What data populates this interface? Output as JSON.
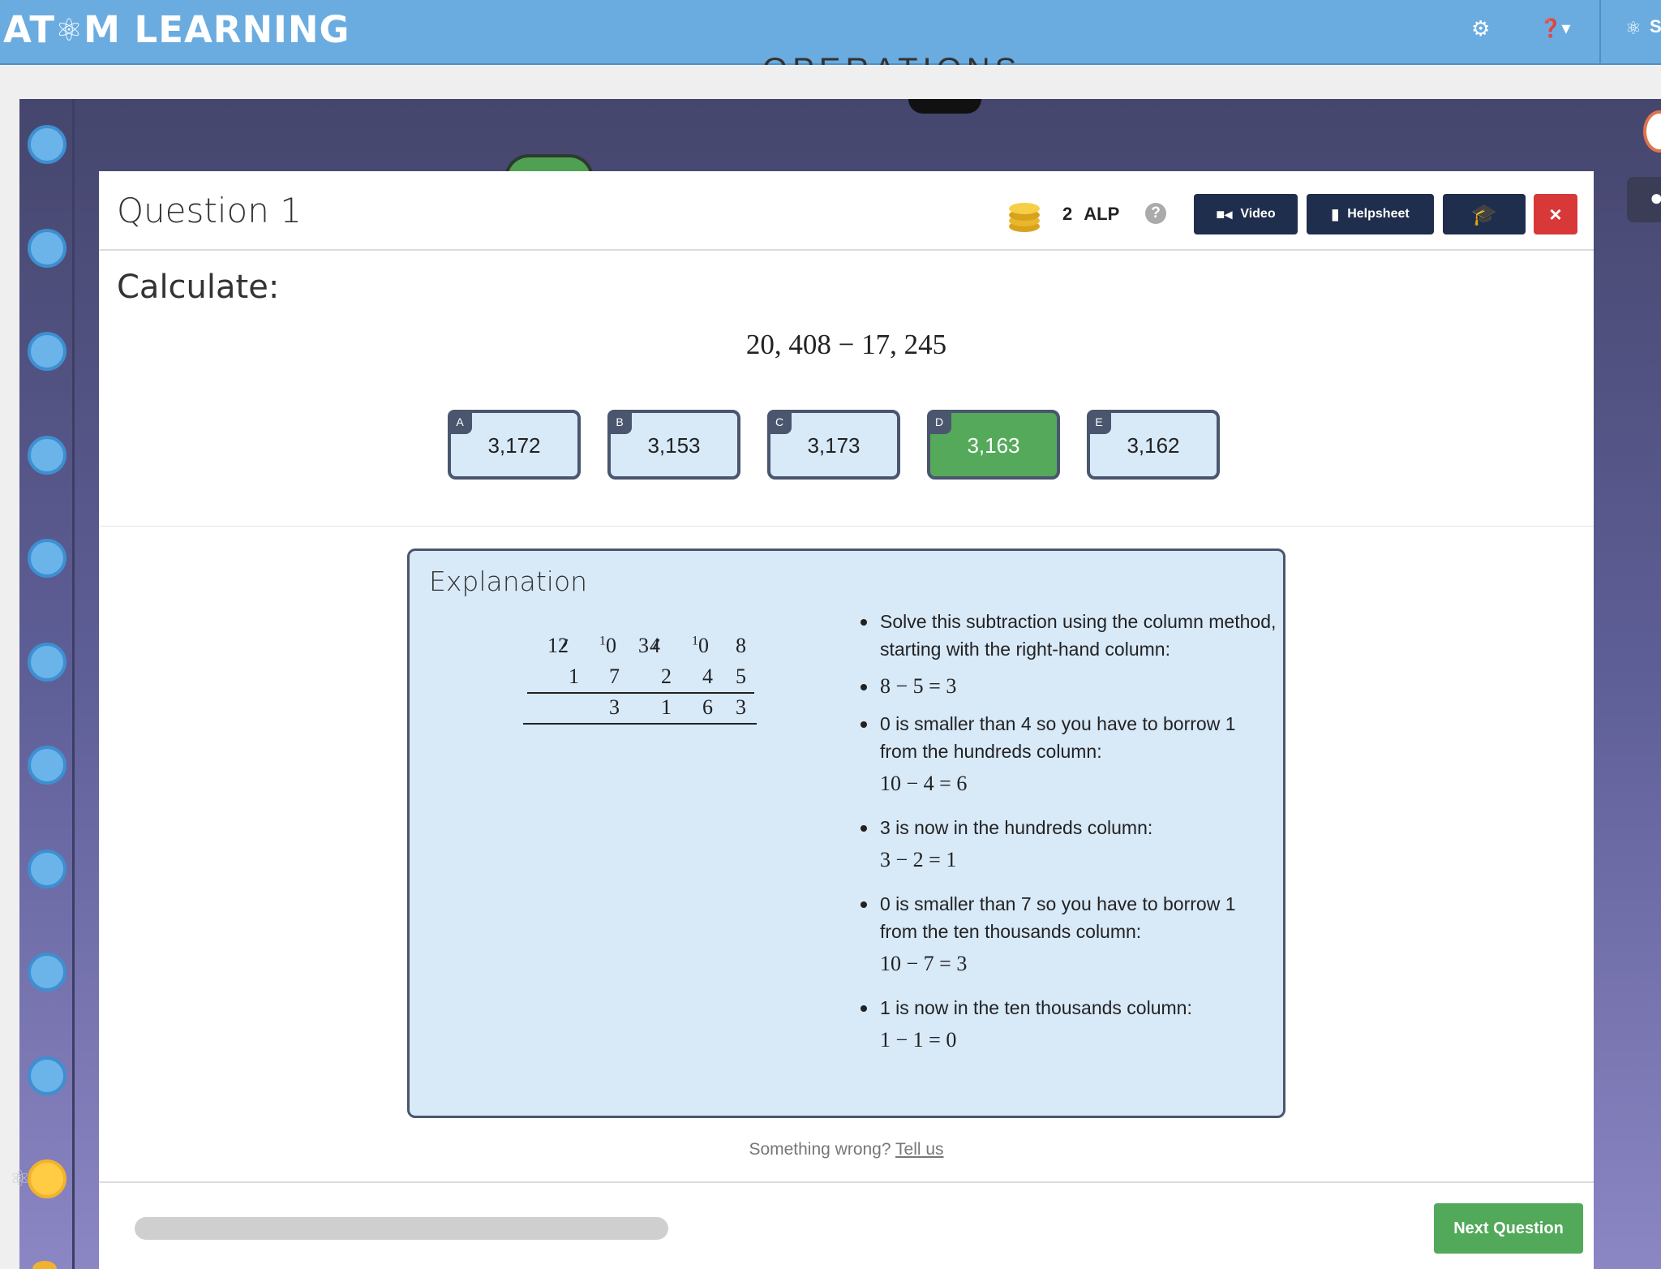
{
  "app": {
    "logo": "AT⚛M LEARNING",
    "logo_pre": "AT",
    "logo_post": "M LEARNING",
    "behind_title": "OPERATIONS",
    "brand_color": "#6aace0"
  },
  "topbar": {
    "settings_icon": "gear-icon",
    "help_icon": "question-icon",
    "profile_initial": "S"
  },
  "question": {
    "title": "Question 1",
    "alp_value": "2",
    "alp_label": "ALP",
    "help": "?",
    "video_label": "Video",
    "helpsheet_label": "Helpsheet",
    "close": "×",
    "prompt": "Calculate:",
    "expression": "20, 408 − 17, 245"
  },
  "options": [
    {
      "letter": "A",
      "value": "3,172",
      "selected": false
    },
    {
      "letter": "B",
      "value": "3,153",
      "selected": false
    },
    {
      "letter": "C",
      "value": "3,173",
      "selected": false
    },
    {
      "letter": "D",
      "value": "3,163",
      "selected": true
    },
    {
      "letter": "E",
      "value": "3,162",
      "selected": false
    }
  ],
  "explanation": {
    "title": "Explanation",
    "column": {
      "row1": [
        "1",
        "2",
        "1",
        "0",
        "3",
        "4",
        "1",
        "0",
        "8"
      ],
      "row2": [
        "1",
        "7",
        "2",
        "4",
        "5"
      ],
      "row3": [
        "3",
        "1",
        "6",
        "3"
      ]
    },
    "steps": [
      {
        "text": "Solve this subtraction using the column method, starting with the right-hand column:",
        "eq": ""
      },
      {
        "text": "8 − 5 = 3",
        "eq": ""
      },
      {
        "text": "0 is smaller than 4 so you have to borrow 1 from the hundreds column:",
        "eq": "10 − 4 = 6"
      },
      {
        "text": "3 is now in the hundreds column:",
        "eq": "3 − 2 = 1"
      },
      {
        "text": "0 is smaller than 7 so you have to borrow 1 from the ten thousands column:",
        "eq": "10 − 7 = 3"
      },
      {
        "text": "1 is now in the ten thousands column:",
        "eq": "1 − 1 = 0"
      }
    ]
  },
  "feedback": {
    "text": "Something wrong?",
    "link": "Tell us"
  },
  "footer": {
    "progress": 0,
    "next_label": "Next Question"
  }
}
